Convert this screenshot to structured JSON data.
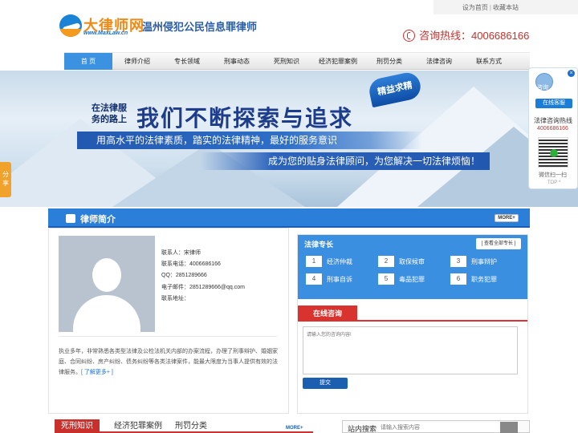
{
  "topbar": {
    "set_home": "设为首页",
    "separator": "|",
    "favorite": "收藏本站"
  },
  "brand": {
    "logo_cn": "大律师网",
    "logo_en": "www.MaxLaw.cn",
    "site_title": "温州侵犯公民信息罪律师"
  },
  "hotline": {
    "text": "咨询热线：4006686166"
  },
  "nav": {
    "items": [
      {
        "label": "首 页",
        "active": true
      },
      {
        "label": "律师介绍"
      },
      {
        "label": "专长领域"
      },
      {
        "label": "刑事动态"
      },
      {
        "label": "死刑知识"
      },
      {
        "label": "经济犯罪案例"
      },
      {
        "label": "刑罚分类"
      },
      {
        "label": "法律咨询"
      },
      {
        "label": "联系方式"
      }
    ]
  },
  "banner": {
    "line1a": "在法律服",
    "line1b": "务的路上",
    "headline": "我们不断探索与追求",
    "seal": "精益求精",
    "stripe1": "用高水平的法律素质，踏实的法律精神，最好的服务意识",
    "stripe2": "成为您的贴身法律顾问，为您解决一切法律烦恼！"
  },
  "share": {
    "label": "分享"
  },
  "float_panel": {
    "avatar_label": "咨询",
    "online_btn": "在线客服",
    "hotline_label": "法律咨询热线",
    "hotline_number": "4006686166",
    "qr_label": "微信扫一扫",
    "top_label": "TOP ^"
  },
  "profile_section": {
    "title": "律师简介",
    "more": "MORE+"
  },
  "profile": {
    "contact": "联系人：宋律师",
    "phone": "联系电话：4006686166",
    "qq": "QQ：2851289666",
    "email": "电子邮件：2851289666@qq.com",
    "address": "联系地址：",
    "intro": "执业多年，非常熟悉各类型法律及公检法机关内部的办案流程，办理了刑事辩护、婚姻家庭、合同纠纷、房产纠纷、债务纠纷等各类法律案件，能最大限度为当事人提供有效的法律服务。",
    "intro_more": "[ 了解更多+ ]"
  },
  "specialties": {
    "title": "法律专长",
    "more": "[ 查看全部专长 ]",
    "items": [
      {
        "num": "1",
        "name": "经济仲裁"
      },
      {
        "num": "2",
        "name": "取保候审"
      },
      {
        "num": "3",
        "name": "刑事辩护"
      },
      {
        "num": "4",
        "name": "刑事自诉"
      },
      {
        "num": "5",
        "name": "毒品犯罪"
      },
      {
        "num": "6",
        "name": "职务犯罪"
      }
    ]
  },
  "consult": {
    "title": "在线咨询",
    "placeholder": "请输入您的咨询内容!",
    "submit": "提交"
  },
  "bottom_tabs": {
    "items": [
      {
        "label": "死刑知识",
        "active": true
      },
      {
        "label": "经济犯罪案例"
      },
      {
        "label": "刑罚分类"
      }
    ],
    "more": "MORE+"
  },
  "site_search": {
    "label": "站内搜索",
    "placeholder": "请输入搜索内容"
  },
  "colors": {
    "primary": "#2c7fd8",
    "accent_red": "#c9302c",
    "brand_orange": "#f08a15"
  }
}
